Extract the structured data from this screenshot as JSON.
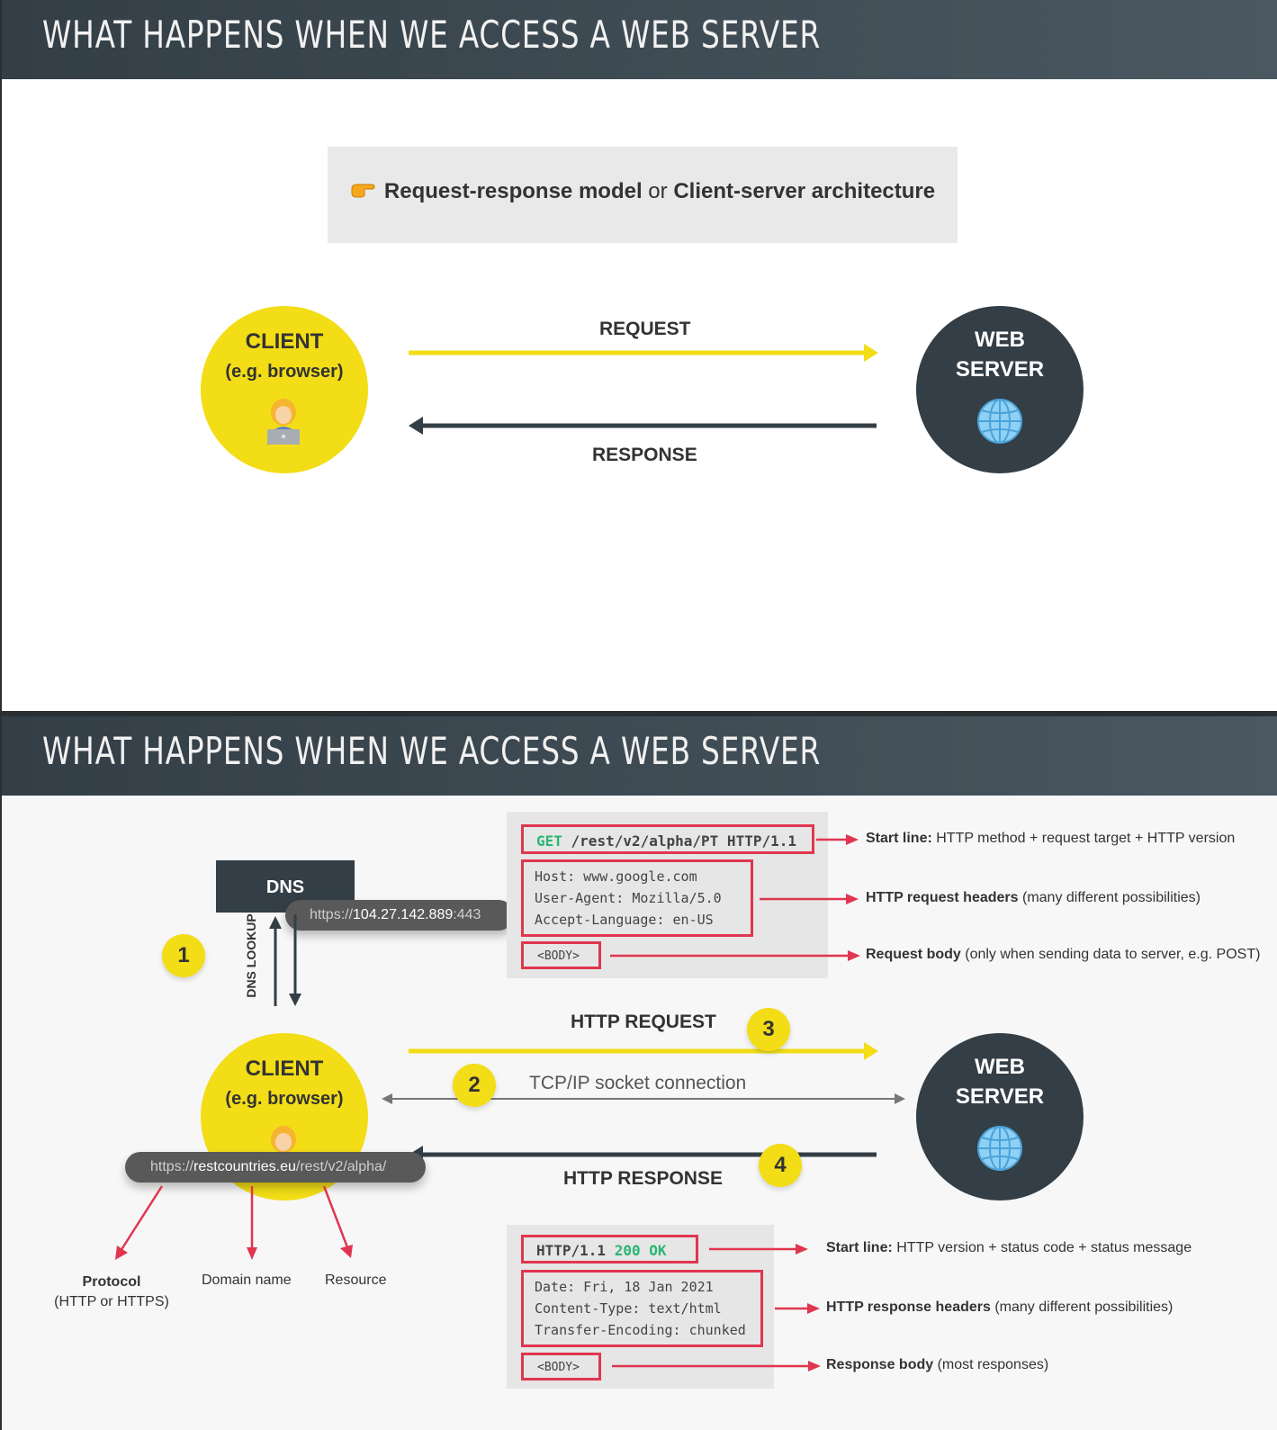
{
  "title": "WHAT HAPPENS WHEN WE ACCESS A WEB SERVER",
  "slide1": {
    "banner": {
      "icon": "pointing-hand-icon",
      "part1": "Request-response model",
      "connector": " or ",
      "part2": "Client-server architecture"
    },
    "client": {
      "title": "CLIENT",
      "subtitle": "(e.g. browser)",
      "icon": "person-laptop-icon"
    },
    "server": {
      "title_line1": "WEB",
      "title_line2": "SERVER",
      "icon": "globe-icon"
    },
    "request_label": "REQUEST",
    "response_label": "RESPONSE"
  },
  "slide2": {
    "dns": {
      "label": "DNS",
      "result_prefix": "https://",
      "result_ip": "104.27.142.889",
      "result_port": ":443",
      "lookup_label": "DNS LOOKUP"
    },
    "steps": [
      "1",
      "2",
      "3",
      "4"
    ],
    "client": {
      "title": "CLIENT",
      "subtitle": "(e.g. browser)"
    },
    "server": {
      "title_line1": "WEB",
      "title_line2": "SERVER"
    },
    "http_request_label": "HTTP REQUEST",
    "tcp_label": "TCP/IP socket connection",
    "http_response_label": "HTTP RESPONSE",
    "url": {
      "protocol": "https://",
      "domain": "restcountries.eu",
      "resource": "/rest/v2/alpha/"
    },
    "url_parts": {
      "protocol_line1": "Protocol",
      "protocol_line2": "(HTTP or HTTPS)",
      "domain": "Domain name",
      "resource": "Resource"
    },
    "request": {
      "start_method": "GET",
      "start_rest": " /rest/v2/alpha/PT HTTP/1.1",
      "headers": [
        "Host: www.google.com",
        "User-Agent: Mozilla/5.0",
        "Accept-Language: en-US"
      ],
      "body": "<BODY>",
      "ann_start_bold": "Start line:",
      "ann_start_rest": " HTTP method + request target + HTTP version",
      "ann_headers_bold": "HTTP request headers",
      "ann_headers_rest": " (many different possibilities)",
      "ann_body_bold": "Request body",
      "ann_body_rest": " (only when sending data to server, e.g. POST)"
    },
    "response": {
      "start_version": "HTTP/1.1 ",
      "start_status": "200 OK",
      "headers": [
        "Date: Fri, 18 Jan 2021",
        "Content-Type: text/html",
        "Transfer-Encoding: chunked"
      ],
      "body": "<BODY>",
      "ann_start_bold": "Start line:",
      "ann_start_rest": " HTTP version + status code + status message",
      "ann_headers_bold": "HTTP response headers",
      "ann_headers_rest": " (many different possibilities)",
      "ann_body_bold": "Response body",
      "ann_body_rest": " (most responses)"
    }
  },
  "colors": {
    "yellow": "#f2dd17",
    "dark": "#333e46",
    "red": "#e0364f",
    "green": "#2bb673"
  }
}
